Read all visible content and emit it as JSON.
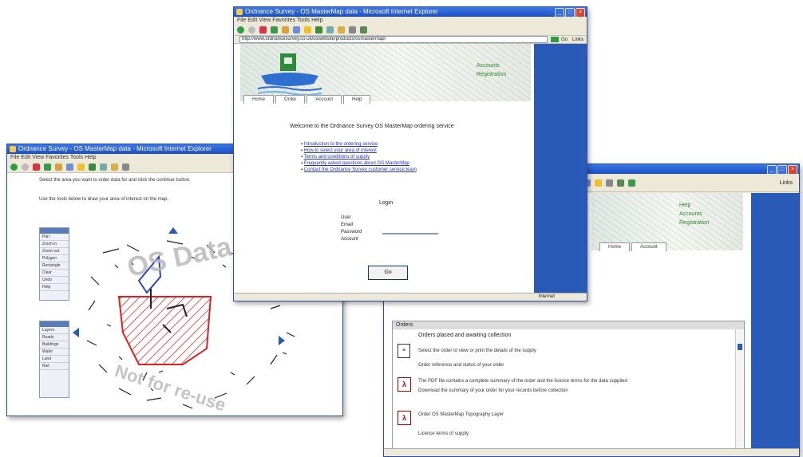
{
  "window_left": {
    "title": "Ordnance Survey - OS MasterMap data - Microsoft Internet Explorer",
    "menu": "File  Edit  View  Favorites  Tools  Help",
    "intro_text": "Select the area you want to order data for and click the continue button.",
    "intro_text2": "Use the tools below to draw your area of interest on the map.",
    "tools_panel": [
      "Pan",
      "Zoom in",
      "Zoom out",
      "Polygon",
      "Rectangle",
      "Clear",
      "Undo",
      "Help"
    ],
    "layers_panel": [
      "Layers",
      "Roads",
      "Buildings",
      "Water",
      "Land",
      "Rail"
    ],
    "watermark_top": "OS Data",
    "watermark_bottom": "Not for re-use",
    "colors": {
      "selection": "#e02020",
      "blue_shape": "#2a44c8"
    }
  },
  "window_center": {
    "title": "Ordnance Survey - OS MasterMap data - Microsoft Internet Explorer",
    "menu": "File  Edit  View  Favorites  Tools  Help",
    "address": "http://www.ordnancesurvey.co.uk/oswebsite/products/osmastermap/",
    "go_label": "Go",
    "links_label": "Links",
    "banner_links": [
      "Accounts",
      "Registration"
    ],
    "tabs": [
      "Home",
      "Order",
      "Account",
      "Help"
    ],
    "heading": "Welcome to the Ordnance Survey OS MasterMap ordering service",
    "links": [
      "Introduction to the ordering service",
      "How to select your area of interest",
      "Terms and conditions of supply",
      "Frequently asked questions about OS MasterMap",
      "Contact the Ordnance Survey customer service team"
    ],
    "login_heading": "Login",
    "login_fields": [
      "User",
      "Email",
      "Password",
      "Account"
    ],
    "login_button": "Go",
    "status": "Internet"
  },
  "window_right": {
    "address_tail": "Links",
    "banner_links": [
      "Help",
      "Accounts",
      "Registration"
    ],
    "tabs": [
      "Home",
      "Account"
    ],
    "section_title": "Orders",
    "heading": "Orders placed and awaiting collection",
    "items": [
      {
        "icon": "document-icon",
        "line1": "Select the order to view or print the details of the supply",
        "line2": "Order reference and status of your order"
      },
      {
        "icon": "pdf-icon",
        "line1": "The PDF file contains a complete summary of the order and the licence terms for the data supplied",
        "line2": "Download the summary of your order for your records before collection"
      },
      {
        "icon": "pdf-icon",
        "line1": "Order OS MasterMap Topography Layer",
        "line2": "Licence terms of supply"
      }
    ]
  }
}
